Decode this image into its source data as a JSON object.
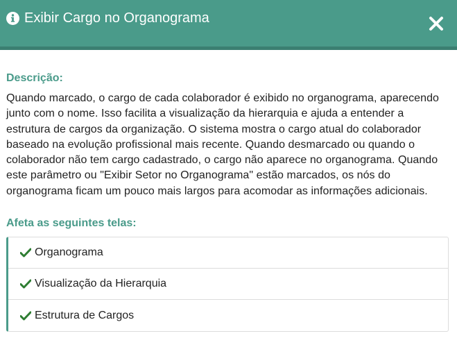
{
  "modal": {
    "title": "Exibir Cargo no Organograma",
    "header_icon": "info-circle-icon",
    "close_icon": "close-icon",
    "colors": {
      "accent": "#4a9b8a",
      "header_border": "#3b7f71",
      "check": "#2e7d32"
    }
  },
  "description": {
    "label": "Descrição:",
    "text": "Quando marcado, o cargo de cada colaborador é exibido no organograma, aparecendo junto com o nome. Isso facilita a visualização da hierarquia e ajuda a entender a estrutura de cargos da organização. O sistema mostra o cargo atual do colaborador baseado na evolução profissional mais recente. Quando desmarcado ou quando o colaborador não tem cargo cadastrado, o cargo não aparece no organograma. Quando este parâmetro ou \"Exibir Setor no Organograma\" estão marcados, os nós do organograma ficam um pouco mais largos para acomodar as informações adicionais."
  },
  "affects": {
    "label": "Afeta as seguintes telas:",
    "item_icon": "check-icon",
    "items": [
      {
        "label": "Organograma"
      },
      {
        "label": "Visualização da Hierarquia"
      },
      {
        "label": "Estrutura de Cargos"
      }
    ]
  }
}
